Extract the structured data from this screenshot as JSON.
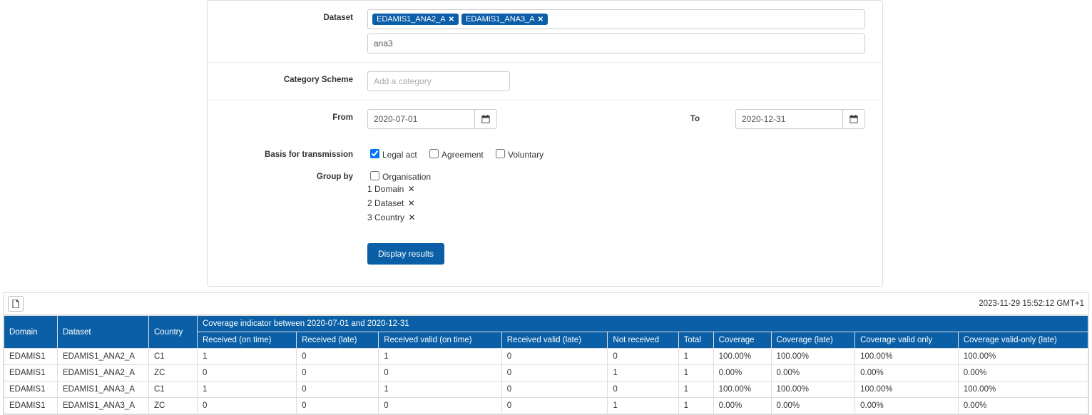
{
  "form": {
    "dataset_label": "Dataset",
    "dataset_tags": [
      "EDAMIS1_ANA2_A",
      "EDAMIS1_ANA3_A"
    ],
    "dataset_search_value": "ana3",
    "category_label": "Category Scheme",
    "category_placeholder": "Add a category",
    "from_label": "From",
    "from_value": "2020-07-01",
    "to_label": "To",
    "to_value": "2020-12-31",
    "basis_label": "Basis for transmission",
    "basis_options": {
      "legal_act": {
        "label": "Legal act",
        "checked": true
      },
      "agreement": {
        "label": "Agreement",
        "checked": false
      },
      "voluntary": {
        "label": "Voluntary",
        "checked": false
      }
    },
    "groupby_label": "Group by",
    "groupby_org_label": "Organisation",
    "groupby_items": [
      {
        "idx": "1",
        "label": "Domain"
      },
      {
        "idx": "2",
        "label": "Dataset"
      },
      {
        "idx": "3",
        "label": "Country"
      }
    ],
    "submit_label": "Display results"
  },
  "results": {
    "timestamp": "2023-11-29 15:52:12 GMT+1",
    "coverage_title": "Coverage indicator between 2020-07-01 and 2020-12-31",
    "columns": {
      "domain": "Domain",
      "dataset": "Dataset",
      "country": "Country",
      "recv_on_time": "Received (on time)",
      "recv_late": "Received (late)",
      "recv_valid_on_time": "Received valid (on time)",
      "recv_valid_late": "Received valid (late)",
      "not_received": "Not received",
      "total": "Total",
      "coverage": "Coverage",
      "coverage_late": "Coverage (late)",
      "coverage_valid_only": "Coverage valid only",
      "coverage_valid_only_late": "Coverage valid-only (late)"
    },
    "rows": [
      {
        "domain": "EDAMIS1",
        "dataset": "EDAMIS1_ANA2_A",
        "country": "C1",
        "r1": "1",
        "r2": "0",
        "r3": "1",
        "r4": "0",
        "r5": "0",
        "r6": "1",
        "c1": "100.00%",
        "c2": "100.00%",
        "c3": "100.00%",
        "c4": "100.00%"
      },
      {
        "domain": "EDAMIS1",
        "dataset": "EDAMIS1_ANA2_A",
        "country": "ZC",
        "r1": "0",
        "r2": "0",
        "r3": "0",
        "r4": "0",
        "r5": "1",
        "r6": "1",
        "c1": "0.00%",
        "c2": "0.00%",
        "c3": "0.00%",
        "c4": "0.00%"
      },
      {
        "domain": "EDAMIS1",
        "dataset": "EDAMIS1_ANA3_A",
        "country": "C1",
        "r1": "1",
        "r2": "0",
        "r3": "1",
        "r4": "0",
        "r5": "0",
        "r6": "1",
        "c1": "100.00%",
        "c2": "100.00%",
        "c3": "100.00%",
        "c4": "100.00%"
      },
      {
        "domain": "EDAMIS1",
        "dataset": "EDAMIS1_ANA3_A",
        "country": "ZC",
        "r1": "0",
        "r2": "0",
        "r3": "0",
        "r4": "0",
        "r5": "1",
        "r6": "1",
        "c1": "0.00%",
        "c2": "0.00%",
        "c3": "0.00%",
        "c4": "0.00%"
      }
    ]
  }
}
